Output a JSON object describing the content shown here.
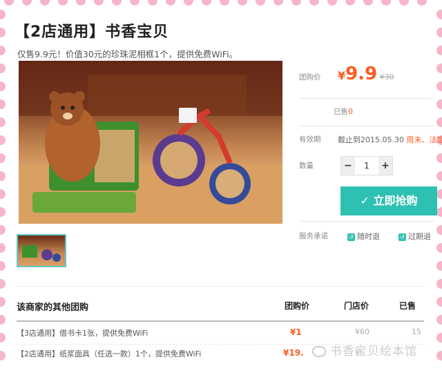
{
  "deal": {
    "title": "【2店通用】书香宝贝",
    "subtitle": "仅售9.9元！价值30元的珍珠泥相框1个，提供免费WiFi。"
  },
  "info": {
    "price_label": "团购价",
    "currency": "¥",
    "price": "9.9",
    "original_price": "¥30",
    "sold_label": "已售",
    "sold_count": "0",
    "validity_label": "有效期",
    "validity_value": "截止到2015.05.30",
    "validity_extra": "周末、法定",
    "quantity_label": "数量",
    "quantity_value": "1",
    "minus": "−",
    "plus": "+",
    "buy_label": "立即抢购",
    "service_label": "服务承诺",
    "service_1": "随时退",
    "service_2": "过期退"
  },
  "other": {
    "heading": "该商家的其他团购",
    "col_price": "团购价",
    "col_store": "门店价",
    "col_sold": "已售",
    "rows": [
      {
        "name": "【3店通用】借书卡1张，提供免费WiFi",
        "price": "¥1",
        "store": "¥60",
        "sold": "15"
      },
      {
        "name": "【2店通用】纸浆面具（任选一款）1个，提供免费WiFi",
        "price": "¥19.",
        "store": "¥",
        "sold": ""
      }
    ]
  },
  "watermark": "书香宝贝绘本馆",
  "colors": {
    "accent": "#2ec1b2",
    "price": "#ff5a1f",
    "dots": "#f7b6c8"
  }
}
